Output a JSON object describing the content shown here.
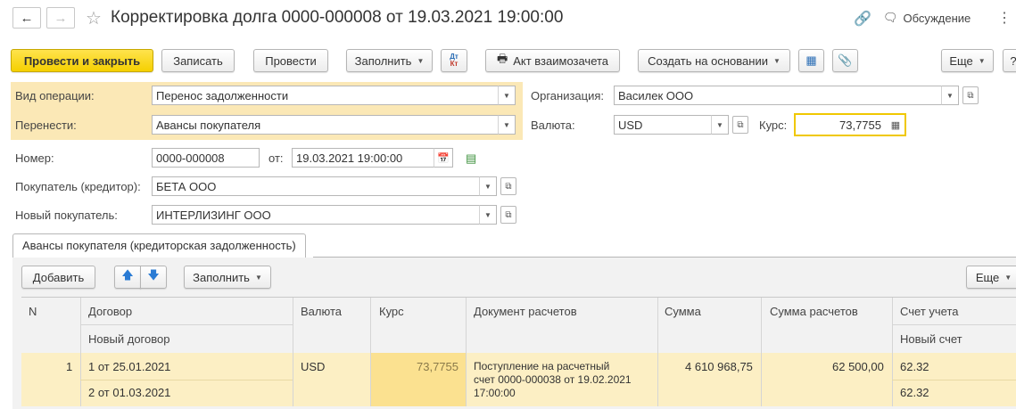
{
  "window": {
    "title": "Корректировка долга 0000-000008 от 19.03.2021 19:00:00",
    "discussion": "Обсуждение"
  },
  "toolbar": {
    "post_close": "Провести и закрыть",
    "save": "Записать",
    "post": "Провести",
    "fill": "Заполнить",
    "dtkt_top": "Дт",
    "dtkt_bottom": "Кт",
    "act": "Акт взаимозачета",
    "create_based": "Создать на основании",
    "more": "Еще",
    "help": "?"
  },
  "form": {
    "operation_label": "Вид операции:",
    "operation_value": "Перенос задолженности",
    "transfer_label": "Перенести:",
    "transfer_value": "Авансы покупателя",
    "org_label": "Организация:",
    "org_value": "Василек ООО",
    "currency_label": "Валюта:",
    "currency_value": "USD",
    "rate_label": "Курс:",
    "rate_value": "73,7755",
    "number_label": "Номер:",
    "number_value": "0000-000008",
    "date_label": "от:",
    "date_value": "19.03.2021 19:00:00",
    "buyer_label": "Покупатель (кредитор):",
    "buyer_value": "БЕТА ООО",
    "newbuyer_label": "Новый покупатель:",
    "newbuyer_value": "ИНТЕРЛИЗИНГ ООО"
  },
  "tabs": [
    "Авансы покупателя (кредиторская задолженность)"
  ],
  "table_toolbar": {
    "add": "Добавить",
    "fill": "Заполнить",
    "more": "Еще"
  },
  "table": {
    "headers": {
      "n": "N",
      "contract": "Договор",
      "new_contract": "Новый договор",
      "currency": "Валюта",
      "rate": "Курс",
      "doc": "Документ расчетов",
      "sum": "Сумма",
      "sum_calc": "Сумма расчетов",
      "account": "Счет учета",
      "new_account": "Новый счет"
    },
    "rows": [
      {
        "n": "1",
        "contract": "1 от 25.01.2021",
        "new_contract": "2 от 01.03.2021",
        "currency": "USD",
        "rate": "73,7755",
        "doc_line1": "Поступление на расчетный",
        "doc_line2": "счет 0000-000038 от 19.02.2021",
        "doc_line3": "17:00:00",
        "sum": "4 610 968,75",
        "sum_calc": "62 500,00",
        "account": "62.32",
        "new_account": "62.32"
      }
    ]
  }
}
